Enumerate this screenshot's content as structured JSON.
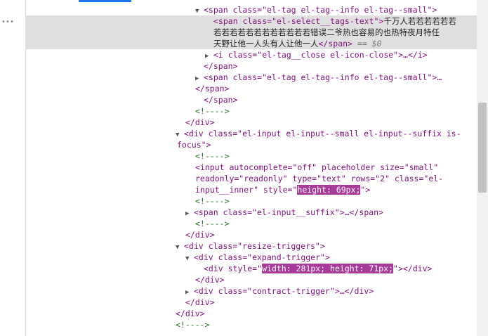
{
  "devtools": {
    "gutter_dots": "•••",
    "selected_eq": "== $0"
  },
  "lines": [
    {
      "t": "▼",
      "a": "<span class=\"el-tag el-tag--info el-tag--small\">"
    },
    {
      "a": "<span class=\"el-select__tags-text\">",
      "b": "千万人若若若若若若",
      "sel": true
    },
    {
      "b": "若若若若若若若若若若若若错误二爷热也容易的也热特夜月特任",
      "sel": true
    },
    {
      "b": "天野让他一人头有人让他一人",
      "c": "</span>",
      "sel": true
    },
    {
      "t": "▶",
      "a": "<i class=\"el-tag__close el-icon-close\">…</i>"
    },
    {
      "a": "</span>"
    },
    {
      "t": "▶",
      "a": "<span class=\"el-tag el-tag--info el-tag--small\">…"
    },
    {
      "a": "</span>"
    },
    {
      "a": "</span>"
    },
    {
      "m": "<!---->"
    },
    {
      "a": "</div>"
    },
    {
      "t": "▼",
      "a": "<div class=\"el-input el-input--small el-input--suffix is-"
    },
    {
      "a": "focus\">"
    },
    {
      "m": "<!---->"
    },
    {
      "a": "<input autocomplete=\"off\" placeholder size=\"small\""
    },
    {
      "a": "readonly=\"readonly\" type=\"text\" rows=\"2\" class=\"el-"
    },
    {
      "a": "input__inner\" style=\"",
      "h": "height: 69px;",
      "z": "\">"
    },
    {
      "m": "<!---->"
    },
    {
      "t": "▶",
      "a": "<span class=\"el-input__suffix\">…</span>"
    },
    {
      "m": "<!---->"
    },
    {
      "a": "</div>"
    },
    {
      "t": "▼",
      "a": "<div class=\"resize-triggers\">"
    },
    {
      "t": "▼",
      "a": "<div class=\"expand-trigger\">"
    },
    {
      "a": "<div style=\"",
      "h": "width: 281px; height: 71px;",
      "z": "\"></div>"
    },
    {
      "a": "</div>"
    },
    {
      "t": "▶",
      "a": "<div class=\"contract-trigger\">…</div>"
    },
    {
      "a": "</div>"
    },
    {
      "a": "</div>"
    },
    {
      "m": "<!---->"
    }
  ]
}
